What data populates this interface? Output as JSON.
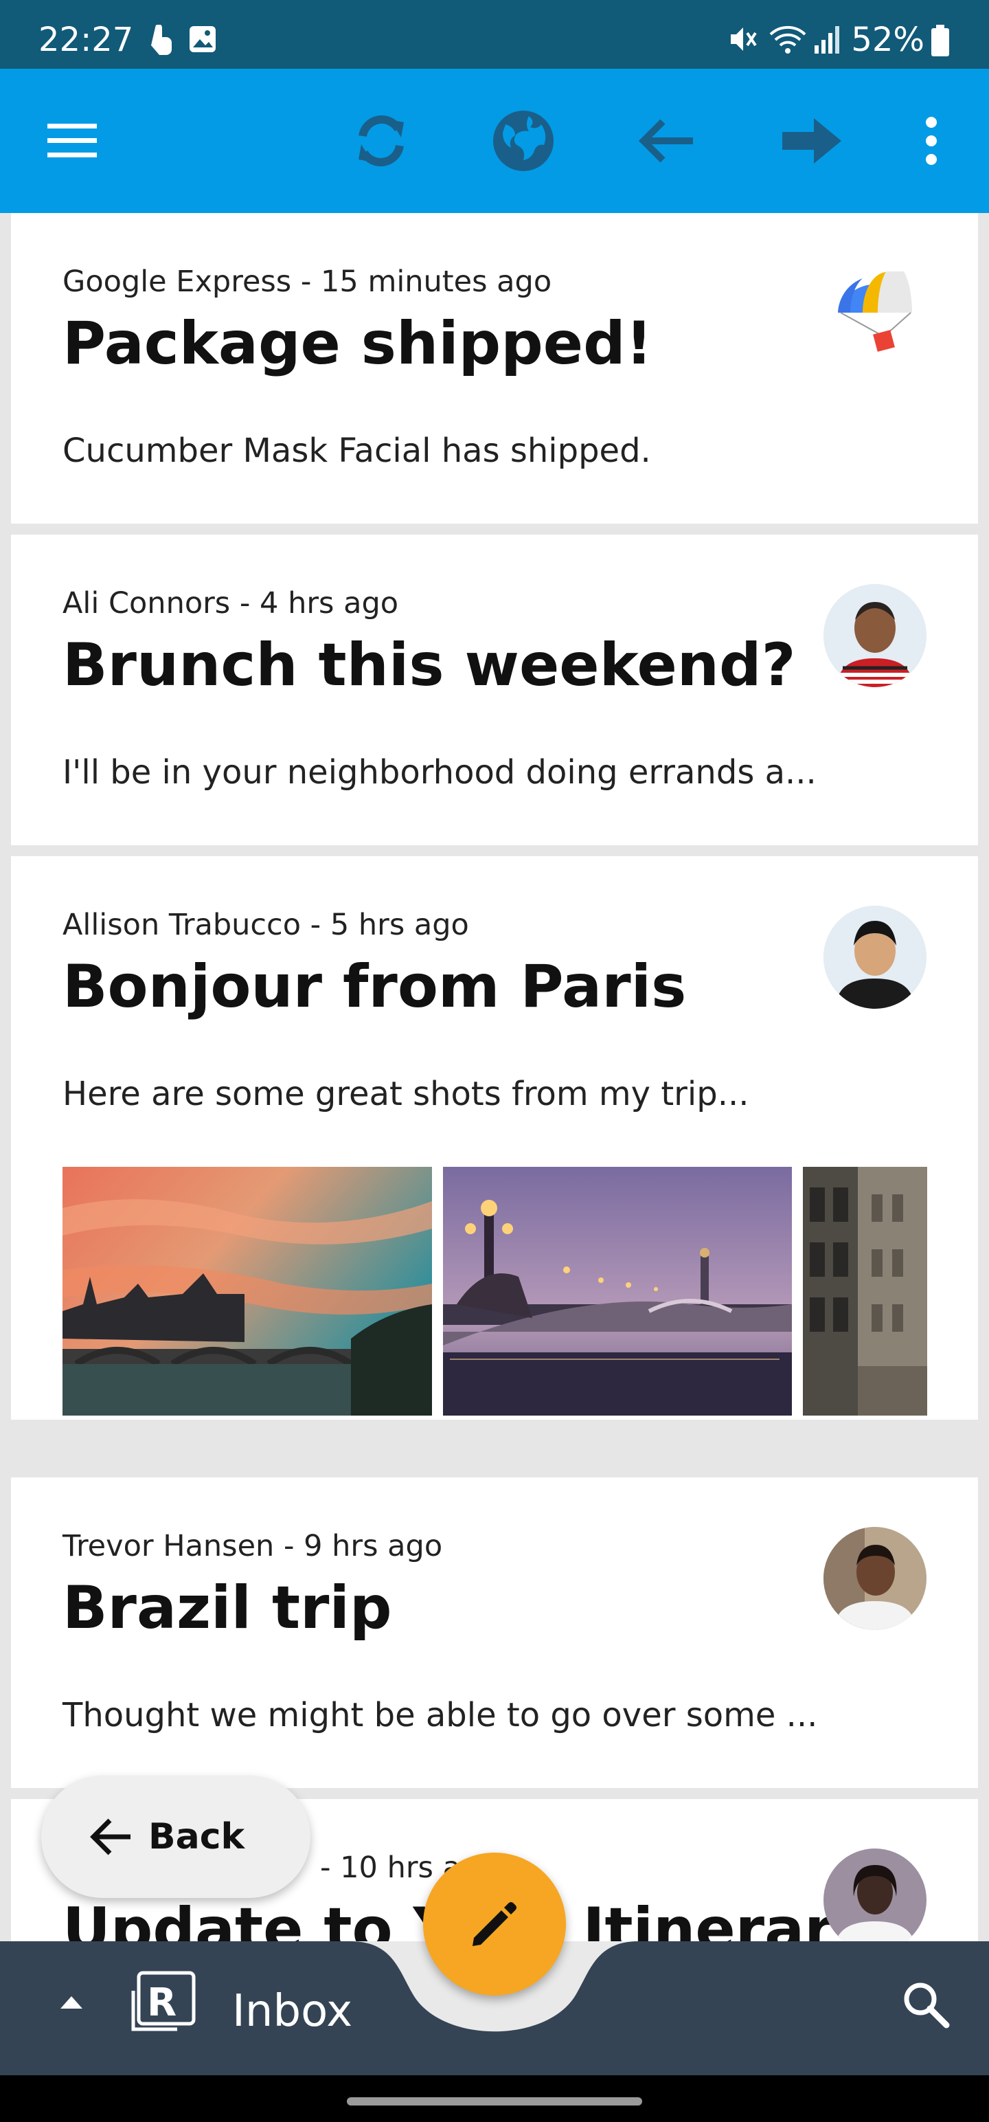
{
  "status_bar": {
    "time": "22:27",
    "battery": "52%"
  },
  "toolbar": {
    "menu_icon": "hamburger-menu-icon",
    "refresh_icon": "refresh-icon",
    "globe_icon": "globe-icon",
    "back_icon": "arrow-back-icon",
    "forward_icon": "arrow-forward-icon",
    "more_icon": "more-vertical-icon"
  },
  "emails": [
    {
      "sender_meta": "Google Express - 15 minutes ago",
      "subject": "Package shipped!",
      "preview": "Cucumber Mask Facial has shipped.",
      "avatar": "google-express-parachute-logo"
    },
    {
      "sender_meta": "Ali Connors - 4 hrs ago",
      "subject": "Brunch this weekend?",
      "preview": "I'll be in your neighborhood doing errands a...",
      "avatar": "ali-connors-avatar"
    },
    {
      "sender_meta": "Allison Trabucco - 5 hrs ago",
      "subject": "Bonjour from Paris",
      "preview": "Here are some great shots from my trip...",
      "avatar": "allison-trabucco-avatar",
      "photos": [
        "paris-sunset-bridge-photo",
        "pont-alexandre-iii-photo",
        "paris-street-buildings-photo"
      ]
    },
    {
      "sender_meta": "Trevor Hansen - 9 hrs ago",
      "subject": "Brazil trip",
      "preview": "Thought we might be able to go over some ...",
      "avatar": "trevor-hansen-avatar"
    },
    {
      "sender_meta": "- 10 hrs ago",
      "subject": "Update to Your Itinerary",
      "preview": "",
      "avatar": "woman-avatar"
    }
  ],
  "back_fab": {
    "label": "Back"
  },
  "bottom_bar": {
    "mailbox_label": "Inbox",
    "expand_icon": "expand-up-icon",
    "logo_icon": "reply-logo-icon",
    "search_icon": "search-icon",
    "compose_icon": "edit-pencil-icon"
  },
  "colors": {
    "app_bar": "#039be5",
    "status_bar": "#115a78",
    "bottom_bar": "#344454",
    "compose_fab": "#f6a623",
    "toolbar_icons": "#1a5f8a"
  }
}
